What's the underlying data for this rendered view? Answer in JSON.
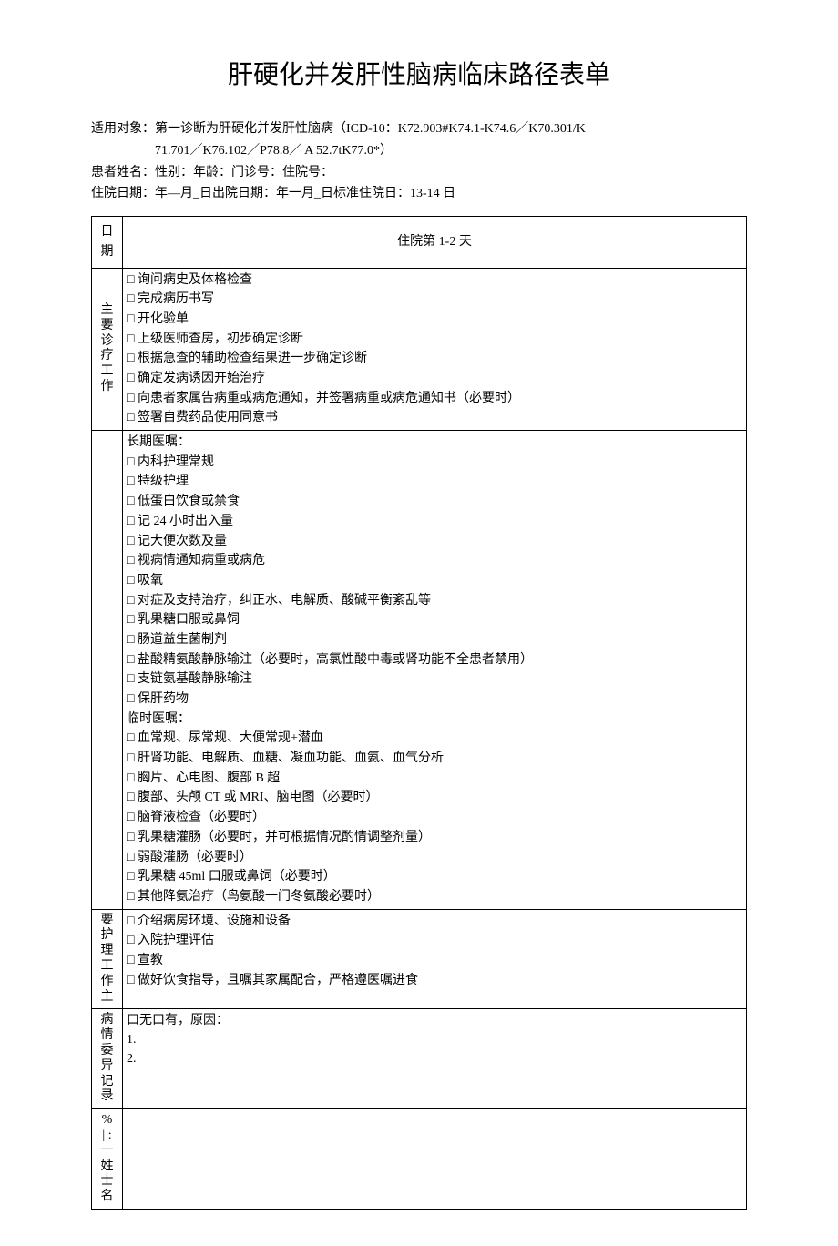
{
  "title": "肝硬化并发肝性脑病临床路径表单",
  "applies_label": "适用对象：",
  "applies_text1": "第一诊断为肝硬化并发肝性脑病（ICD-10：K72.903#K74.1-K74.6／K70.301/K",
  "applies_text2": "71.701／K76.102／P78.8／ A 52.7tK77.0*）",
  "patient_line": "患者姓名：性别：年龄：门诊号：住院号：",
  "admission_line": "住院日期：年—月_日出院日期：年一月_日标准住院日：13-14 日",
  "col_date": "日期",
  "col_day12": "住院第 1-2 天",
  "label_main_work": "主要诊疗工作",
  "label_orders": "",
  "label_nursing": "要护理工作主",
  "label_variance": "病情委异记录",
  "label_nurse_sig": "% | : 一姓士名",
  "main_work": [
    "询问病史及体格检查",
    "完成病历书写",
    "开化验单",
    "上级医师查房，初步确定诊断",
    "根据急查的辅助检查结果进一步确定诊断",
    "确定发病诱因开始治疗",
    "向患者家属告病重或病危通知，并签署病重或病危通知书（必要时）",
    "签署自费药品使用同意书"
  ],
  "long_orders_hdr": "长期医嘱：",
  "long_orders": [
    "内科护理常规",
    "特级护理",
    "低蛋白饮食或禁食",
    "记 24 小时出入量",
    "记大便次数及量",
    "视病情通知病重或病危",
    "吸氧",
    "对症及支持治疗，纠正水、电解质、酸碱平衡紊乱等",
    "乳果糖口服或鼻饲",
    "肠道益生菌制剂",
    "盐酸精氨酸静脉输注（必要时，高氯性酸中毒或肾功能不全患者禁用）",
    "支链氨基酸静脉输注",
    "保肝药物"
  ],
  "temp_orders_hdr": "临时医嘱：",
  "temp_orders": [
    "血常规、尿常规、大便常规+潜血",
    "肝肾功能、电解质、血糖、凝血功能、血氨、血气分析",
    "胸片、心电图、腹部 B 超",
    "腹部、头颅 CT 或 MRI、脑电图（必要时）",
    "脑脊液检查（必要时）",
    "乳果糖灌肠（必要时，并可根据情况酌情调整剂量）",
    "弱酸灌肠（必要时）",
    "乳果糖 45ml 口服或鼻饲（必要时）",
    "其他降氨治疗（鸟氨酸一门冬氨酸必要时）"
  ],
  "nursing": [
    "介绍病房环境、设施和设备",
    "入院护理评估",
    "宣教",
    "做好饮食指导，且嘱其家属配合，严格遵医嘱进食"
  ],
  "variance_line1": "口无口有，原因：",
  "variance_line2": "1.",
  "variance_line3": "2."
}
